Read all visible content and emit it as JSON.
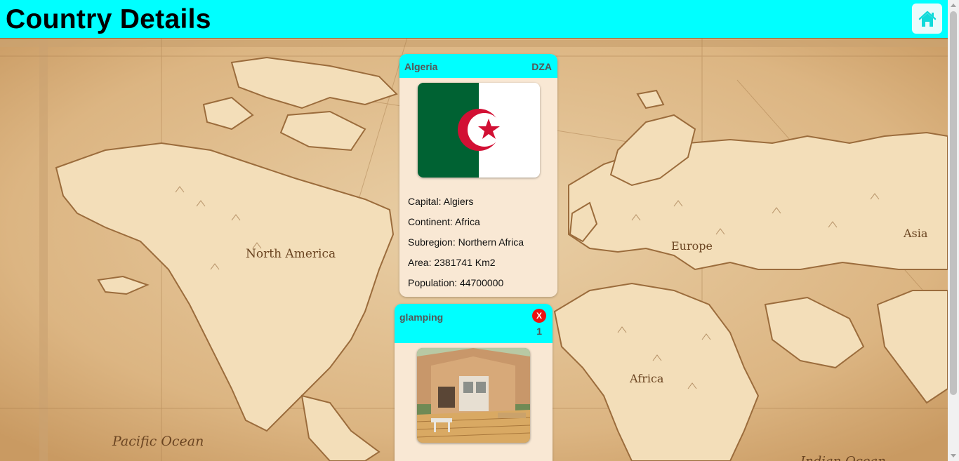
{
  "header": {
    "title": "Country Details",
    "home_icon": "home-icon",
    "accent_color": "#00ffff"
  },
  "map": {
    "labels": {
      "north_america": "North America",
      "europe": "Europe",
      "asia": "Asia",
      "africa": "Africa",
      "pacific_ocean": "Pacific Ocean",
      "indian_ocean": "Indian Ocean"
    }
  },
  "country": {
    "name": "Algeria",
    "code": "DZA",
    "flag_colors": {
      "green": "#006233",
      "white": "#ffffff",
      "red": "#d21034"
    },
    "capital": "Capital: Algiers",
    "continent": "Continent: Africa",
    "subregion": "Subregion: Northern Africa",
    "area": "Area: 2381741 Km2",
    "population": "Population: 44700000"
  },
  "activity": {
    "name": "glamping",
    "count": "1",
    "delete_label": "X",
    "delete_color": "#ee1111"
  }
}
